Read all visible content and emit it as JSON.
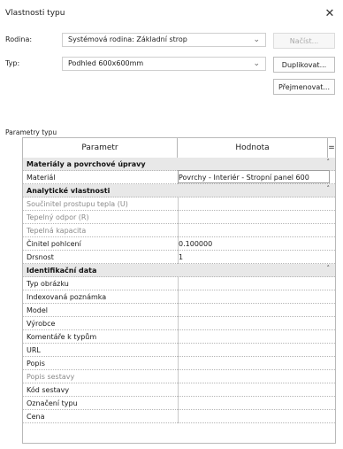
{
  "window": {
    "title": "Vlastnosti typu",
    "close_icon": "close-icon"
  },
  "family": {
    "label": "Rodina:",
    "value": "Systémová rodina: Základní strop"
  },
  "type": {
    "label": "Typ:",
    "value": "Podhled 600x600mm"
  },
  "buttons": {
    "load": "Načíst...",
    "duplicate": "Duplikovat...",
    "rename": "Přejmenovat..."
  },
  "section": {
    "label": "Parametry typu"
  },
  "grid": {
    "col_param": "Parametr",
    "col_value": "Hodnota",
    "col_extra": "="
  },
  "rows": [
    {
      "kind": "group",
      "param": "Materiály a povrchové úpravy",
      "value": ""
    },
    {
      "kind": "row",
      "param": "Materiál",
      "value": "Povrchy - Interiér - Stropní panel 600"
    },
    {
      "kind": "group",
      "param": "Analytické vlastnosti",
      "value": ""
    },
    {
      "kind": "row",
      "param": "Součinitel prostupu tepla (U)",
      "value": ""
    },
    {
      "kind": "row",
      "param": "Tepelný odpor (R)",
      "value": ""
    },
    {
      "kind": "row",
      "param": "Tepelná kapacita",
      "value": ""
    },
    {
      "kind": "row",
      "param": "Činitel pohlcení",
      "value": "0.100000"
    },
    {
      "kind": "row",
      "param": "Drsnost",
      "value": "1"
    },
    {
      "kind": "group",
      "param": "Identifikační data",
      "value": ""
    },
    {
      "kind": "row",
      "param": "Typ obrázku",
      "value": ""
    },
    {
      "kind": "row",
      "param": "Indexovaná poznámka",
      "value": ""
    },
    {
      "kind": "row",
      "param": "Model",
      "value": ""
    },
    {
      "kind": "row",
      "param": "Výrobce",
      "value": ""
    },
    {
      "kind": "row",
      "param": "Komentáře k typům",
      "value": ""
    },
    {
      "kind": "row",
      "param": "URL",
      "value": ""
    },
    {
      "kind": "row",
      "param": "Popis",
      "value": ""
    },
    {
      "kind": "row",
      "param": "Popis sestavy",
      "value": ""
    },
    {
      "kind": "row",
      "param": "Kód sestavy",
      "value": ""
    },
    {
      "kind": "row",
      "param": "Označení typu",
      "value": ""
    },
    {
      "kind": "row",
      "param": "Cena",
      "value": ""
    }
  ]
}
